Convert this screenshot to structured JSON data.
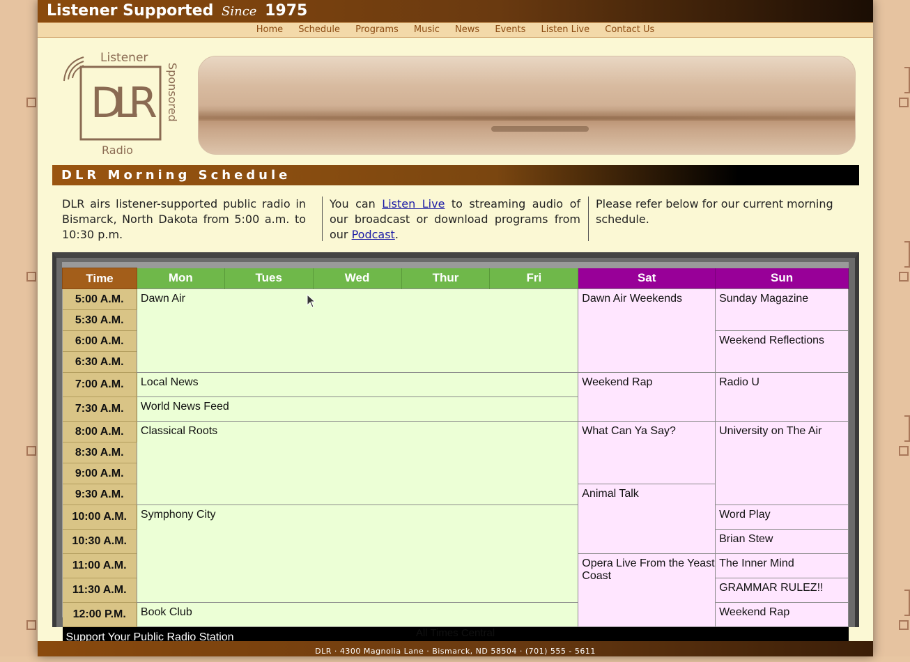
{
  "top": {
    "brand": "Listener Supported",
    "since": "Since",
    "year": "1975"
  },
  "nav": [
    "Home",
    "Schedule",
    "Programs",
    "Music",
    "News",
    "Events",
    "Listen Live",
    "Contact Us"
  ],
  "logo": {
    "letters": "DLR",
    "top": "Listener",
    "side": "Sponsored",
    "bottom": "Radio"
  },
  "section_title": "DLR Morning Schedule",
  "intro": {
    "col1": "DLR airs listener-supported public radio in Bismarck, North Dakota from 5:00 a.m. to 10:30 p.m.",
    "col2_pre": "You can ",
    "col2_link1": "Listen Live",
    "col2_mid": " to streaming audio of our broadcast or download programs from our ",
    "col2_link2": "Podcast",
    "col2_post": ".",
    "col3": "Please refer below for our current morning schedule."
  },
  "schedule": {
    "headers": {
      "time": "Time",
      "mon": "Mon",
      "tue": "Tues",
      "wed": "Wed",
      "thu": "Thur",
      "fri": "Fri",
      "sat": "Sat",
      "sun": "Sun"
    },
    "times": [
      "5:00 A.M.",
      "5:30 A.M.",
      "6:00 A.M.",
      "6:30 A.M.",
      "7:00 A.M.",
      "7:30 A.M.",
      "8:00 A.M.",
      "8:30 A.M.",
      "9:00 A.M.",
      "9:30 A.M.",
      "10:00 A.M.",
      "10:30 A.M.",
      "11:00 A.M.",
      "11:30 A.M.",
      "12:00 P.M."
    ],
    "weekday": [
      "Dawn Air",
      "Local News",
      "World News Feed",
      "Classical Roots",
      "Symphony City",
      "Book Club"
    ],
    "saturday": [
      "Dawn Air Weekends",
      "Weekend Rap",
      "What Can Ya Say?",
      "Animal Talk",
      "Opera Live From the Yeast Coast"
    ],
    "sunday": [
      "Sunday Magazine",
      "Weekend Reflections",
      "Radio U",
      "University on The Air",
      "Word Play",
      "Brian Stew",
      "The Inner Mind",
      "GRAMMAR RULEZ!!",
      "Weekend Rap"
    ],
    "footer": "Support Your Public Radio Station"
  },
  "note": "All Times Central",
  "footer": "DLR · 4300 Magnolia Lane · Bismarck, ND 58504 · (701) 555 - 5611",
  "colors": {
    "brand_brown": "#8a4a0d",
    "weekday_green": "#6fb84a",
    "weekend_purple": "#980098",
    "weekday_cell": "#ecffd6",
    "weekend_cell": "#ffe6ff",
    "time_cell": "#d9c486"
  }
}
